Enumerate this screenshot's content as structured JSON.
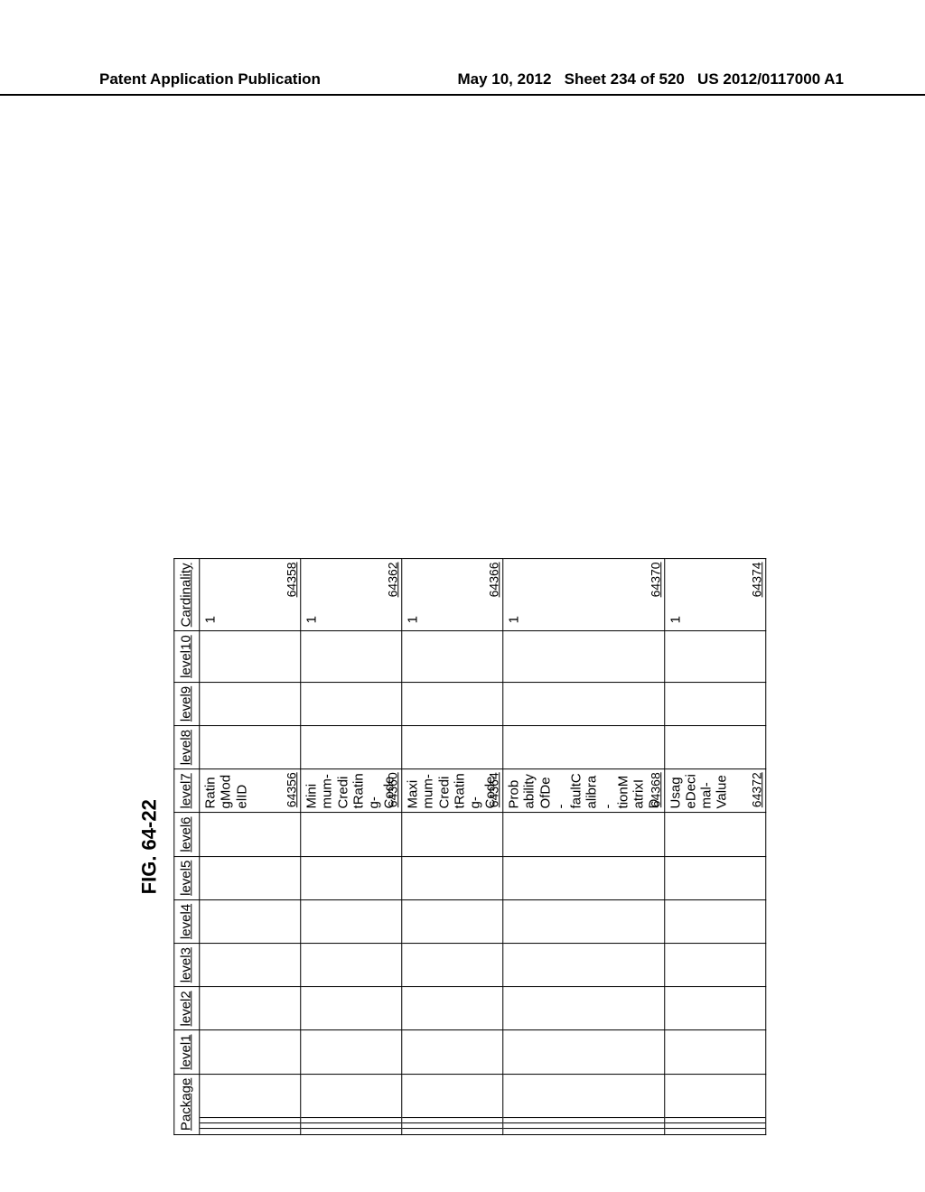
{
  "header": {
    "left": "Patent Application Publication",
    "right_date": "May 10, 2012",
    "right_sheet": "Sheet 234 of 520",
    "right_pubno": "US 2012/0117000 A1"
  },
  "figure_label": "FIG. 64-22",
  "columns": [
    "Package",
    "level1",
    "level2",
    "level3",
    "level4",
    "level5",
    "level6",
    "level7",
    "level8",
    "level9",
    "level10",
    "Cardinality"
  ],
  "rows": [
    {
      "level7": "RatingModelID",
      "level7_ref": "64356",
      "cardinality": "1",
      "card_ref": "64358"
    },
    {
      "level7": "Minimum-CreditRating-Code",
      "level7_ref": "64360",
      "cardinality": "1",
      "card_ref": "64362"
    },
    {
      "level7": "Maximum-CreditRating-Code",
      "level7_ref": "64364",
      "cardinality": "1",
      "card_ref": "64366"
    },
    {
      "level7": "ProbabilityOfDe-faultCalibra-tionMatrixID",
      "level7_ref": "64368",
      "cardinality": "1",
      "card_ref": "64370"
    },
    {
      "level7": "UsageDecimal-Value",
      "level7_ref": "64372",
      "cardinality": "1",
      "card_ref": "64374"
    }
  ]
}
